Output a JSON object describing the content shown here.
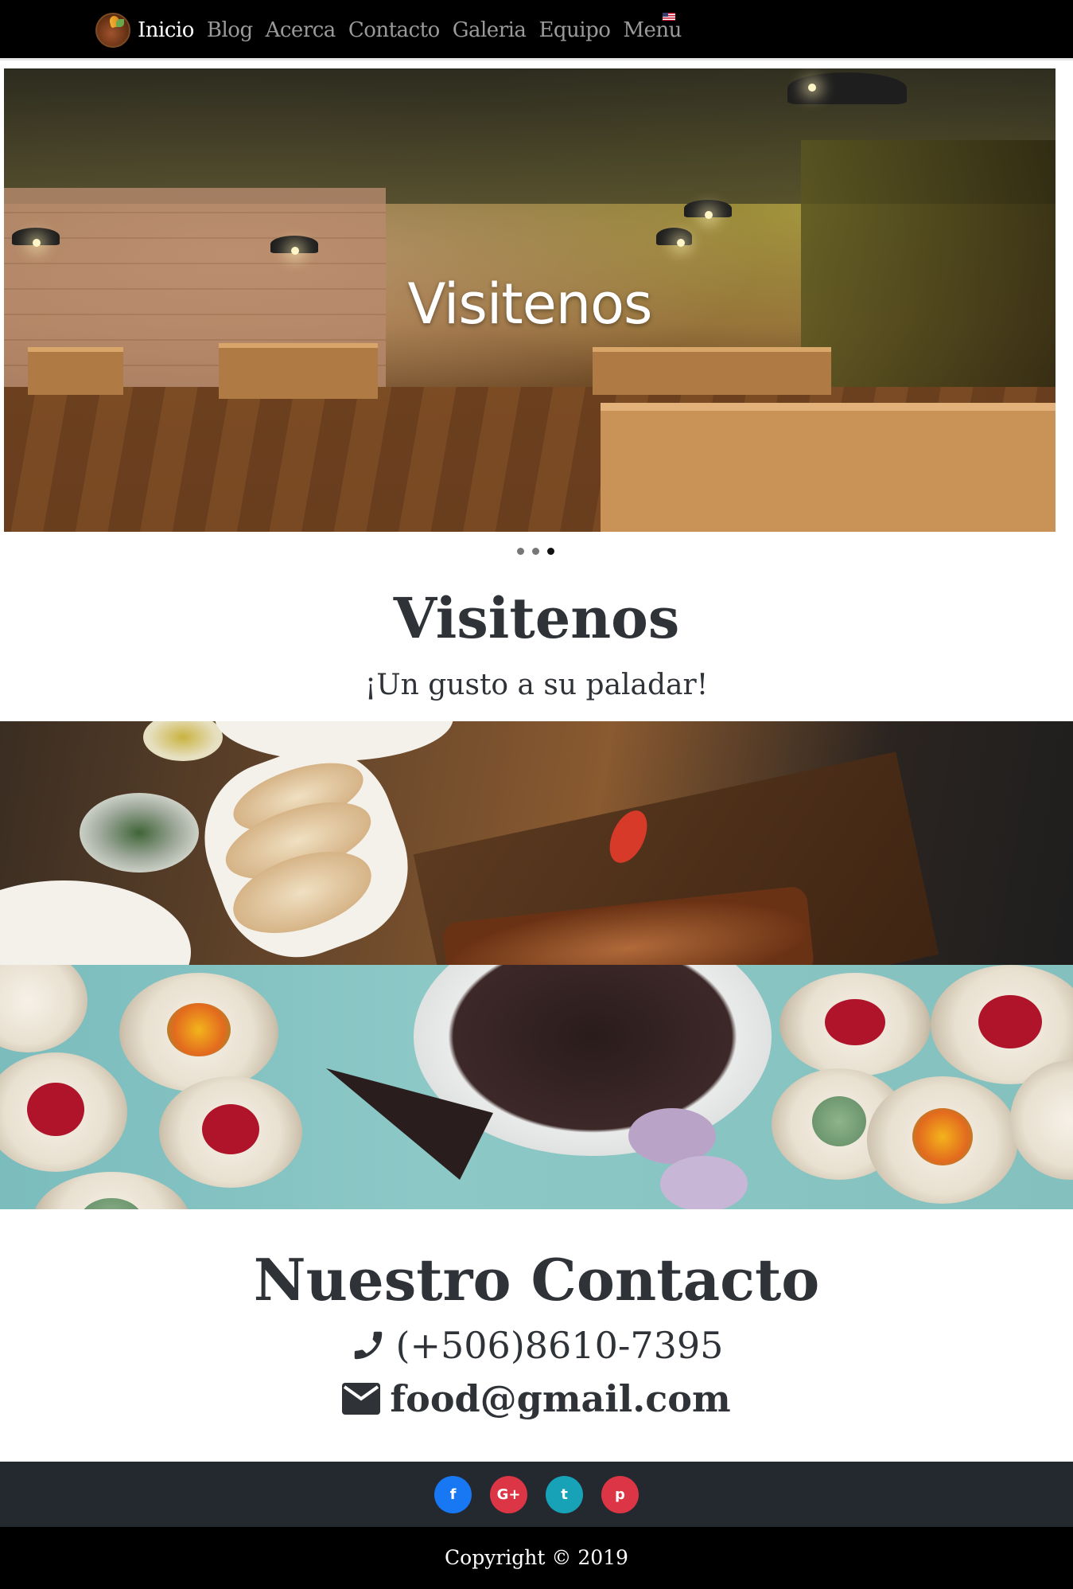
{
  "nav": {
    "logo_icon": "restaurant-logo-icon",
    "items": [
      {
        "label": "Inicio",
        "active": true
      },
      {
        "label": "Blog",
        "active": false
      },
      {
        "label": "Acerca",
        "active": false
      },
      {
        "label": "Contacto",
        "active": false
      },
      {
        "label": "Galeria",
        "active": false
      },
      {
        "label": "Equipo",
        "active": false
      },
      {
        "label": "Menu",
        "active": false
      }
    ],
    "language_icon": "us-flag-icon"
  },
  "hero": {
    "caption": "Visitenos",
    "indicators": [
      false,
      false,
      true
    ]
  },
  "section": {
    "title": "Visitenos",
    "subtitle": "¡Un gusto a su paladar!"
  },
  "contact": {
    "title": "Nuestro Contacto",
    "phone": "(+506)8610-7395",
    "phone_icon": "phone-icon",
    "email": "food@gmail.com",
    "email_icon": "envelope-icon"
  },
  "social": [
    {
      "icon": "facebook-icon",
      "glyph": "f",
      "color": "#1877f2"
    },
    {
      "icon": "google-plus-icon",
      "glyph": "G+",
      "color": "#dc3545"
    },
    {
      "icon": "twitter-icon",
      "glyph": "t",
      "color": "#17a2b8"
    },
    {
      "icon": "pinterest-icon",
      "glyph": "p",
      "color": "#dc3545"
    }
  ],
  "footer": {
    "copyright": "Copyright © 2019"
  }
}
